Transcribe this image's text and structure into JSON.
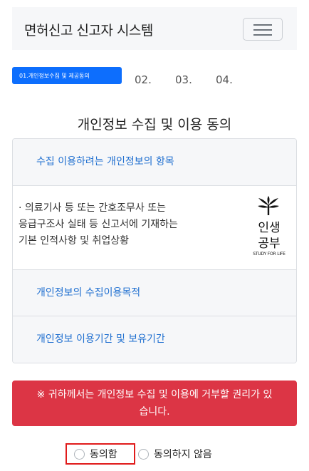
{
  "header": {
    "title": "면허신고 신고자 시스템",
    "menu_icon": "hamburger-icon"
  },
  "steps": {
    "active_label": "01.개인정보수집 및 제공동의",
    "items": [
      "02.",
      "03.",
      "04."
    ]
  },
  "consent": {
    "title": "개인정보 수집 및 이용 동의",
    "sections": [
      {
        "heading": "수집 이용하려는 개인정보의 항목"
      },
      {
        "heading": "개인정보의 수집이용목적"
      },
      {
        "heading": "개인정보 이용기간 및 보유기간"
      }
    ],
    "body_lines": [
      "· 의료기사 등 또는 간호조무사 또는",
      "응급구조사 실태 등 신고서에 기재하는",
      "기본 인적사항 및 취업상황"
    ],
    "logo": {
      "line1": "인생",
      "line2": "공부",
      "tagline": "STUDY FOR LIFE"
    }
  },
  "alert": {
    "line1": "※ 귀하께서는 개인정보 수집 및 이용에 거부할 권리가 있",
    "line2": "습니다."
  },
  "choices": {
    "agree": "동의함",
    "disagree": "동의하지 않음"
  },
  "colors": {
    "primary": "#0d6efd",
    "link": "#1f6fd0",
    "danger": "#dc3545",
    "highlight": "#e01b1b"
  }
}
